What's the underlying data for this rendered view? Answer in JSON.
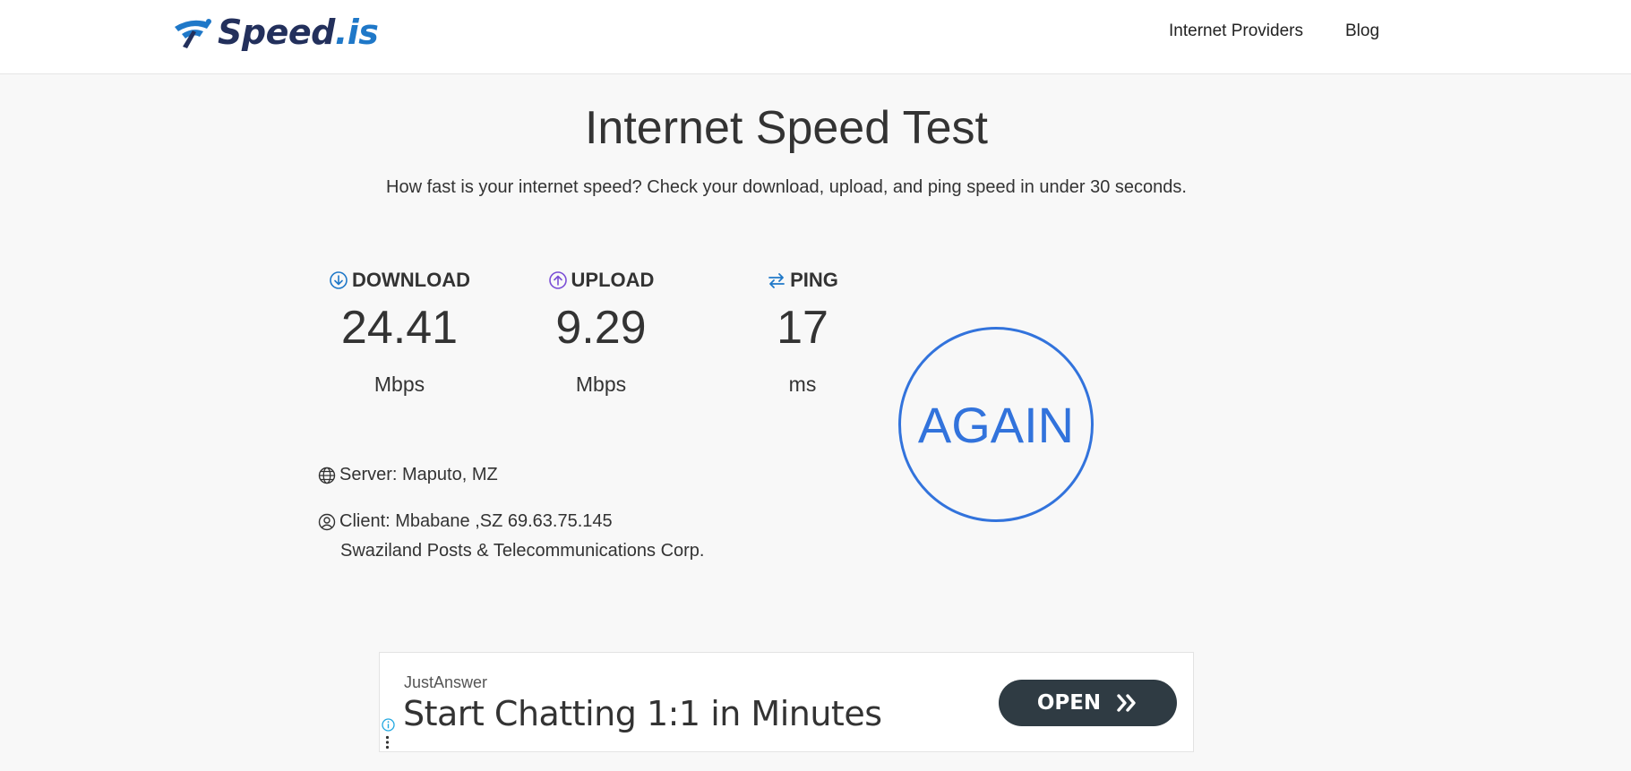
{
  "header": {
    "logo_main": "Speed",
    "logo_suffix": ".is",
    "nav": [
      {
        "label": "Internet Providers"
      },
      {
        "label": "Blog"
      }
    ]
  },
  "hero": {
    "title": "Internet Speed Test",
    "subtitle": "How fast is your internet speed? Check your download, upload, and ping speed in under 30 seconds."
  },
  "metrics": {
    "download": {
      "label": "DOWNLOAD",
      "value": "24.41",
      "unit": "Mbps",
      "icon": "download-icon"
    },
    "upload": {
      "label": "UPLOAD",
      "value": "9.29",
      "unit": "Mbps",
      "icon": "upload-icon"
    },
    "ping": {
      "label": "PING",
      "value": "17",
      "unit": "ms",
      "icon": "ping-icon"
    }
  },
  "again_button": {
    "label": "AGAIN"
  },
  "server": {
    "text": "Server: Maputo, MZ",
    "icon": "globe-icon"
  },
  "client": {
    "text": "Client: Mbabane ,SZ 69.63.75.145",
    "isp": "Swaziland Posts & Telecommunications Corp.",
    "icon": "user-circle-icon"
  },
  "ad": {
    "advertiser": "JustAnswer",
    "headline": "Start Chatting 1:1 in Minutes",
    "button_label": "OPEN"
  },
  "colors": {
    "accent_blue": "#3273dc",
    "logo_dark": "#23305c",
    "logo_blue": "#1f78c8",
    "upload_purple": "#7b4fd6",
    "ad_button": "#2f3b43",
    "background": "#f8f8f8"
  }
}
